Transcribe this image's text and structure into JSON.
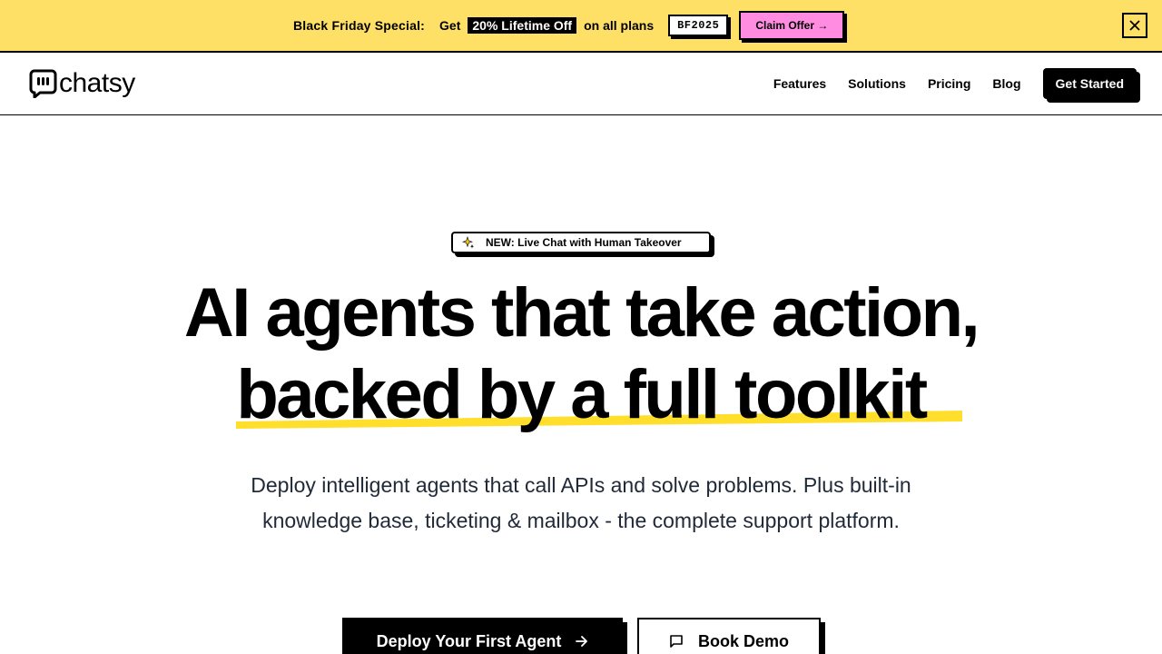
{
  "promo": {
    "lead": "Black Friday Special:",
    "get": "Get",
    "highlight": "20% Lifetime Off",
    "tail": "on all plans",
    "code": "BF2025",
    "claim_label": "Claim Offer →"
  },
  "nav": {
    "logo_text": "chatsy",
    "links": [
      "Features",
      "Solutions",
      "Pricing",
      "Blog"
    ],
    "cta_label": "Get Started"
  },
  "hero": {
    "badge_label": "NEW: Live Chat with Human Takeover",
    "headline_line1": "AI agents that take action,",
    "headline_line2": "backed by a full toolkit",
    "subtitle": "Deploy intelligent agents that call APIs and solve problems. Plus built-in knowledge base, ticketing & mailbox - the complete support platform.",
    "primary_cta": "Deploy Your First Agent",
    "secondary_cta": "Book Demo"
  },
  "icons": {
    "badge": "sparkles-icon",
    "primary_cta": "arrow-right-icon",
    "secondary_cta": "message-square-icon",
    "close": "close-icon",
    "logo": "chat-bubble-icon"
  },
  "colors": {
    "banner_bg": "#ffe066",
    "claim_bg": "#ff8ce0",
    "highlight_yellow": "#ffdf2b",
    "text": "#000000",
    "subtitle": "#1f2937"
  }
}
